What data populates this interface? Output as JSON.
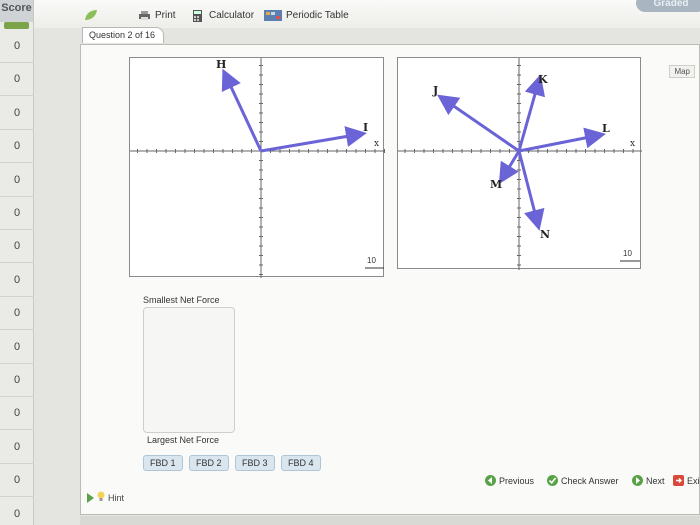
{
  "score_column": {
    "header": "Score",
    "values": [
      "0",
      "0",
      "0",
      "0",
      "0",
      "0",
      "0",
      "0",
      "0",
      "0",
      "0",
      "0",
      "0",
      "0",
      "0"
    ]
  },
  "toolbar": {
    "print_label": "Print",
    "calculator_label": "Calculator",
    "periodic_table_label": "Periodic Table",
    "graded_label": "Graded"
  },
  "question": {
    "tab_label": "Question 2 of 16",
    "map_label": "Map"
  },
  "fbd1": {
    "vectors": [
      "H",
      "I"
    ],
    "x_axis_label": "x",
    "scale_label": "10"
  },
  "fbd2": {
    "vectors": [
      "J",
      "K",
      "L",
      "M",
      "N"
    ],
    "x_axis_label": "x",
    "scale_label": "10"
  },
  "ranking": {
    "smallest_label": "Smallest Net Force",
    "largest_label": "Largest Net Force",
    "fbd_buttons": [
      "FBD 1",
      "FBD 2",
      "FBD 3",
      "FBD 4"
    ]
  },
  "footer": {
    "previous_label": "Previous",
    "check_answer_label": "Check Answer",
    "next_label": "Next",
    "exit_label": "Exi",
    "hint_label": "Hint"
  },
  "colors": {
    "vector": "#6a64d6",
    "button_bg": "#d9e6ef",
    "accent_green": "#5aa248"
  }
}
